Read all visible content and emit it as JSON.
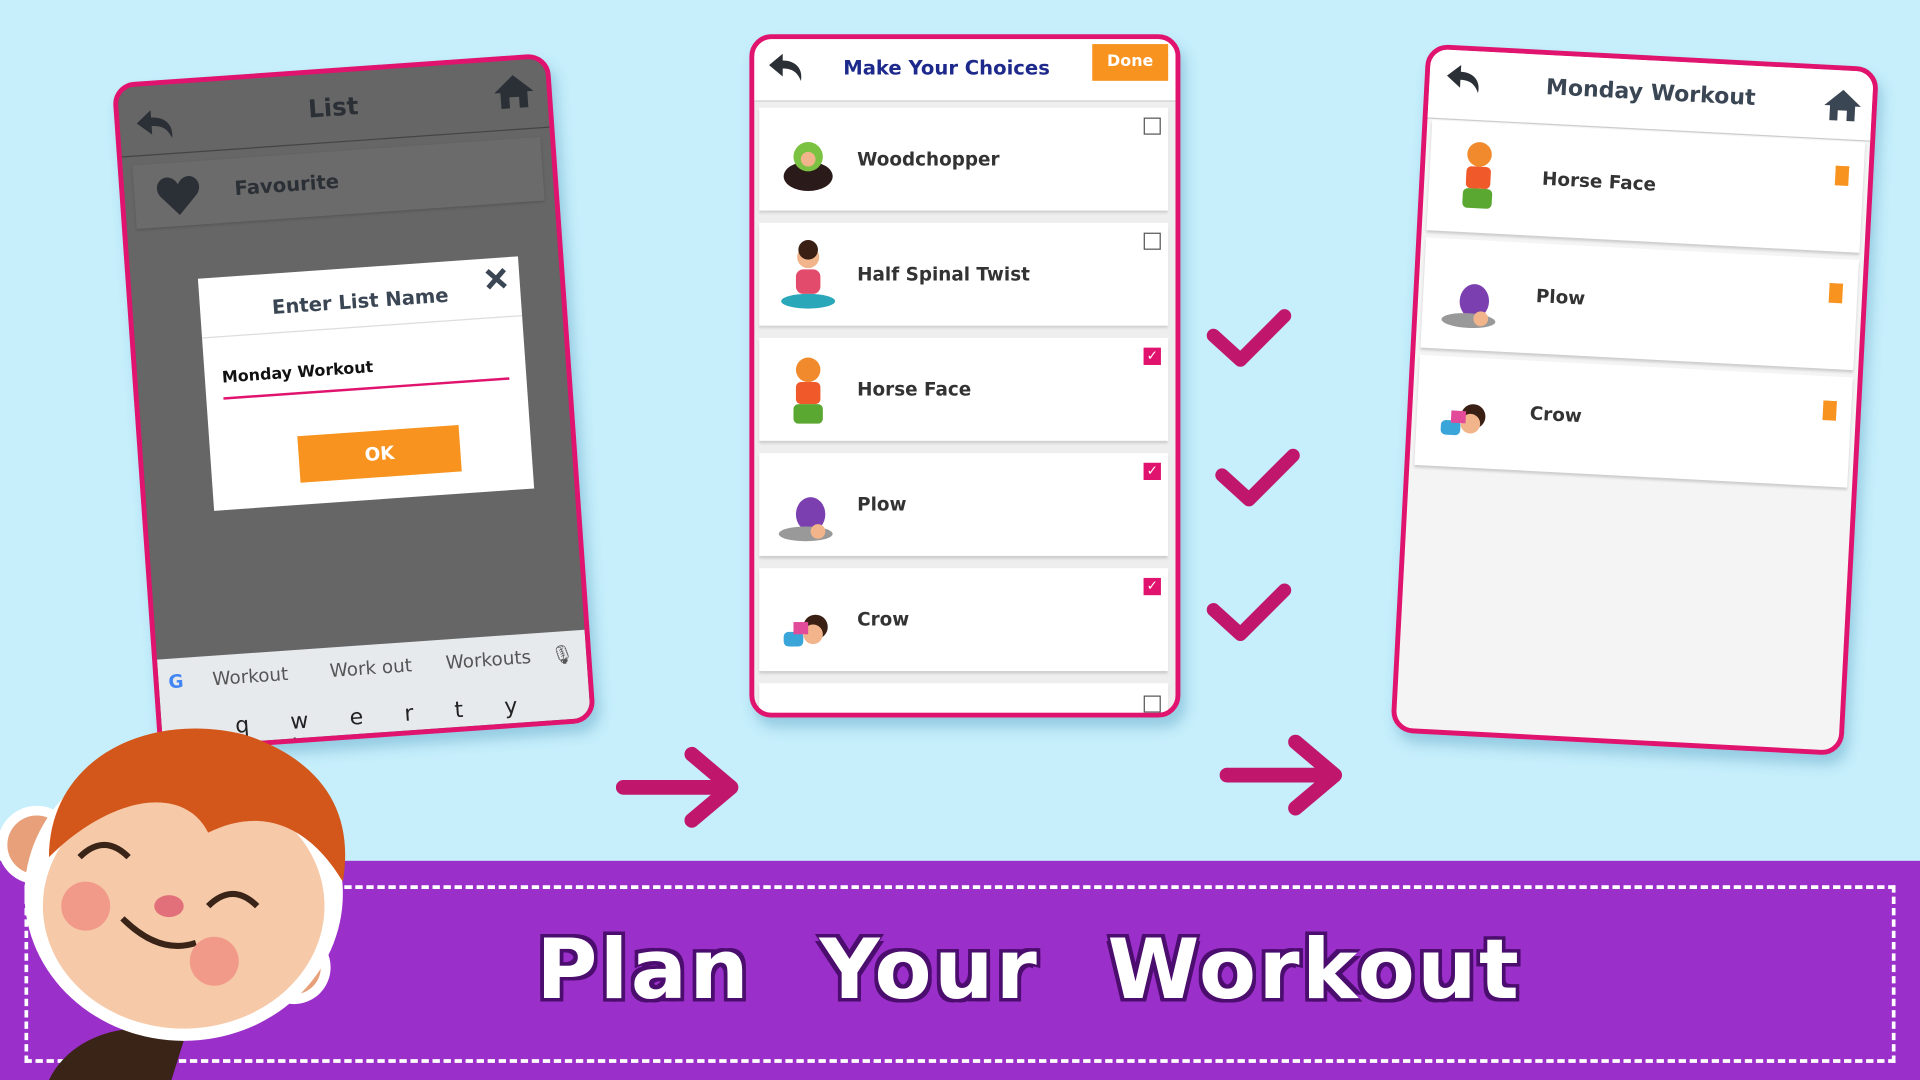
{
  "left_screen": {
    "title": "List",
    "favourite_label": "Favourite",
    "dialog": {
      "title": "Enter List Name",
      "input_value": "Monday Workout",
      "ok_label": "OK"
    },
    "keyboard": {
      "suggestions": [
        "Workout",
        "Work out",
        "Workouts"
      ],
      "keys": "q w e r t y u i o p"
    }
  },
  "middle_screen": {
    "title": "Make Your Choices",
    "done_label": "Done",
    "items": [
      {
        "label": "Woodchopper",
        "checked": false
      },
      {
        "label": "Half Spinal Twist",
        "checked": false
      },
      {
        "label": "Horse Face",
        "checked": true
      },
      {
        "label": "Plow",
        "checked": true
      },
      {
        "label": "Crow",
        "checked": true
      }
    ]
  },
  "right_screen": {
    "title": "Monday Workout",
    "items": [
      {
        "label": "Horse Face"
      },
      {
        "label": "Plow"
      },
      {
        "label": "Crow"
      }
    ]
  },
  "banner": {
    "text": "Plan Your Workout"
  },
  "colors": {
    "accent_pink": "#e0136e",
    "orange": "#f7931e",
    "purple": "#9b2fc9",
    "background": "#c6eefb"
  }
}
